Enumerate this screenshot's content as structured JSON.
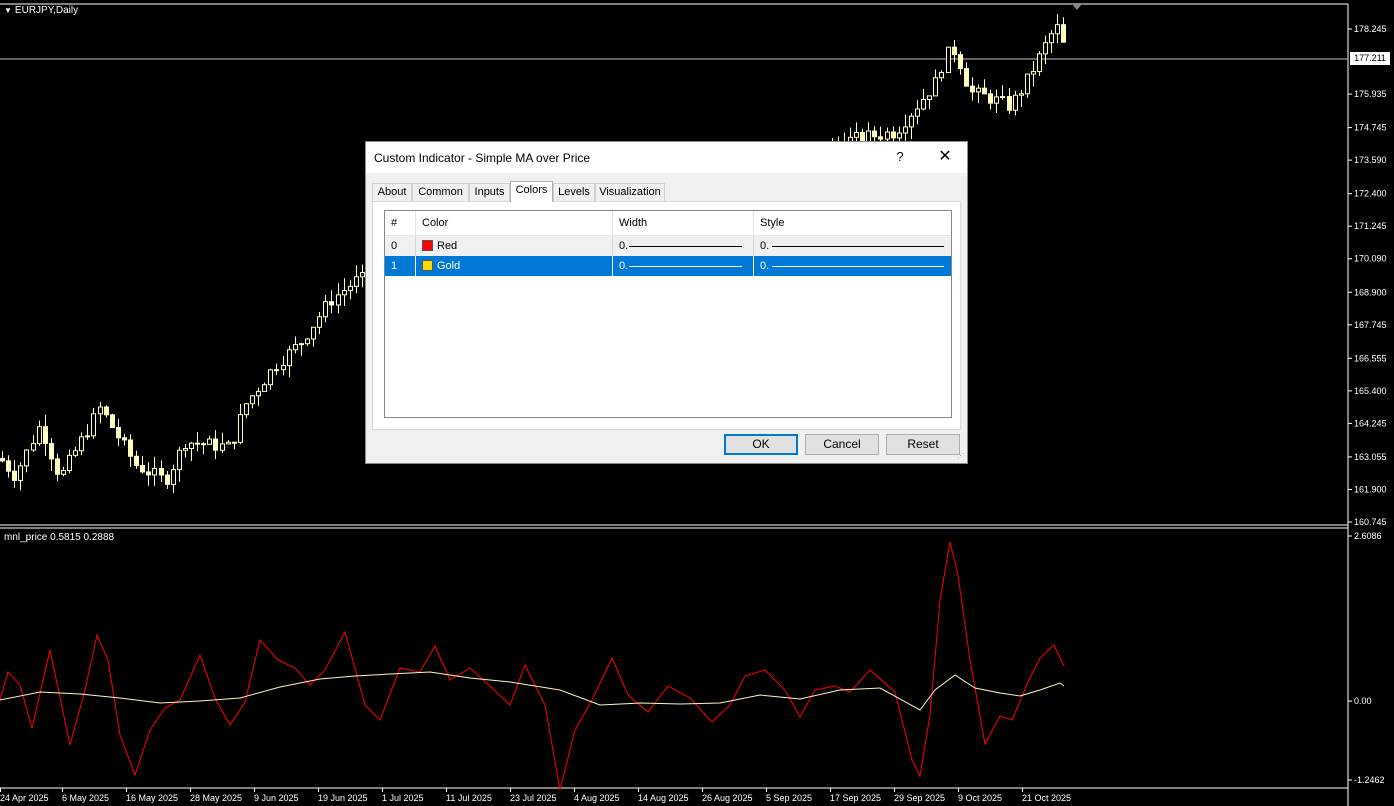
{
  "chart": {
    "symbol_label": "EURJPY,Daily",
    "current_price": "177.211",
    "indicator_label": "mnl_price 0.5815 0.2888",
    "price_axis": [
      "178.245",
      "177.211",
      "175.935",
      "174.745",
      "173.590",
      "172.400",
      "171.245",
      "170.090",
      "168.900",
      "167.745",
      "166.555",
      "165.400",
      "164.245",
      "163.055",
      "161.900",
      "160.745"
    ],
    "indicator_axis": [
      "2.6086",
      "0.00",
      "-1.2462"
    ],
    "date_axis": [
      "24 Apr 2025",
      "6 May 2025",
      "16 May 2025",
      "28 May 2025",
      "9 Jun 2025",
      "19 Jun 2025",
      "1 Jul 2025",
      "11 Jul 2025",
      "23 Jul 2025",
      "4 Aug 2025",
      "14 Aug 2025",
      "26 Aug 2025",
      "5 Sep 2025",
      "17 Sep 2025",
      "29 Sep 2025",
      "9 Oct 2025",
      "21 Oct 2025"
    ],
    "colors": {
      "candle": "#ffffc0",
      "red_line": "#ff0000",
      "gold_line": "#fff2c8",
      "text": "#ffffff"
    }
  },
  "dialog": {
    "title": "Custom Indicator - Simple MA over Price",
    "help_label": "?",
    "close_label": "✕",
    "tabs": [
      "About",
      "Common",
      "Inputs",
      "Colors",
      "Levels",
      "Visualization"
    ],
    "active_tab": "Colors",
    "columns": [
      "#",
      "Color",
      "Width",
      "Style"
    ],
    "rows": [
      {
        "index": "0",
        "color_name": "Red",
        "color_hex": "#ff0000",
        "width": "0.",
        "style": "0.",
        "selected": false
      },
      {
        "index": "1",
        "color_name": "Gold",
        "color_hex": "#ffd700",
        "width": "0.",
        "style": "0.",
        "selected": true
      }
    ],
    "buttons": {
      "ok": "OK",
      "cancel": "Cancel",
      "reset": "Reset"
    }
  }
}
